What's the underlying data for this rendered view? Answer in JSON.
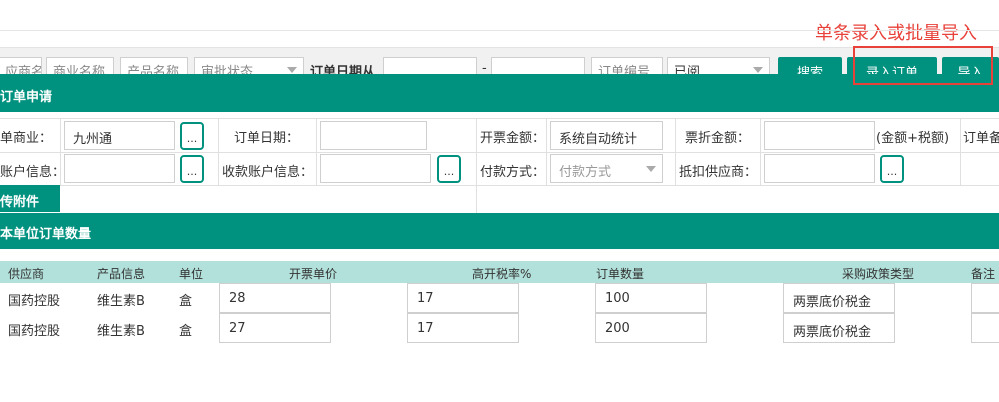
{
  "annotation": "单条录入或批量导入",
  "search": {
    "fields": [
      "应商名",
      "商业名称",
      "产品名称",
      "审批状态",
      "订单编号",
      "已阅"
    ],
    "date_label": "订单日期从",
    "date_sep": "-",
    "buttons": {
      "search": "搜索",
      "entry": "录入订单",
      "import": "导入"
    }
  },
  "section_order": "订单申请",
  "form": {
    "labels": {
      "commercial": "单商业：",
      "order_date": "订单日期：",
      "invoice_amount": "开票金额：",
      "discount_amount": "票折金额：",
      "amount_note": "(金额+税额)",
      "order_remark": "订单备",
      "account_info": "账户信息：",
      "receive_account": "收款账户信息：",
      "payment_method": "付款方式：",
      "deduct_supplier": "抵扣供应商："
    },
    "values": {
      "commercial": "九州通",
      "invoice_amount": "系统自动统计",
      "payment_method": "付款方式"
    },
    "dots": "..."
  },
  "attach_label": "传附件",
  "section_qty": "本单位订单数量",
  "table": {
    "headers": [
      "供应商",
      "产品信息",
      "单位",
      "开票单价",
      "高开税率%",
      "订单数量",
      "采购政策类型",
      "备注"
    ],
    "rows": [
      {
        "supplier": "国药控股",
        "product": "维生素B",
        "unit": "盒",
        "price": "28",
        "tax": "17",
        "qty": "100",
        "policy": "两票底价税金"
      },
      {
        "supplier": "国药控股",
        "product": "维生素B",
        "unit": "盒",
        "price": "27",
        "tax": "17",
        "qty": "200",
        "policy": "两票底价税金"
      }
    ]
  },
  "colors": {
    "teal": "#00917f",
    "header_bg": "#b2e0da",
    "annotation_red": "#e8413a"
  }
}
